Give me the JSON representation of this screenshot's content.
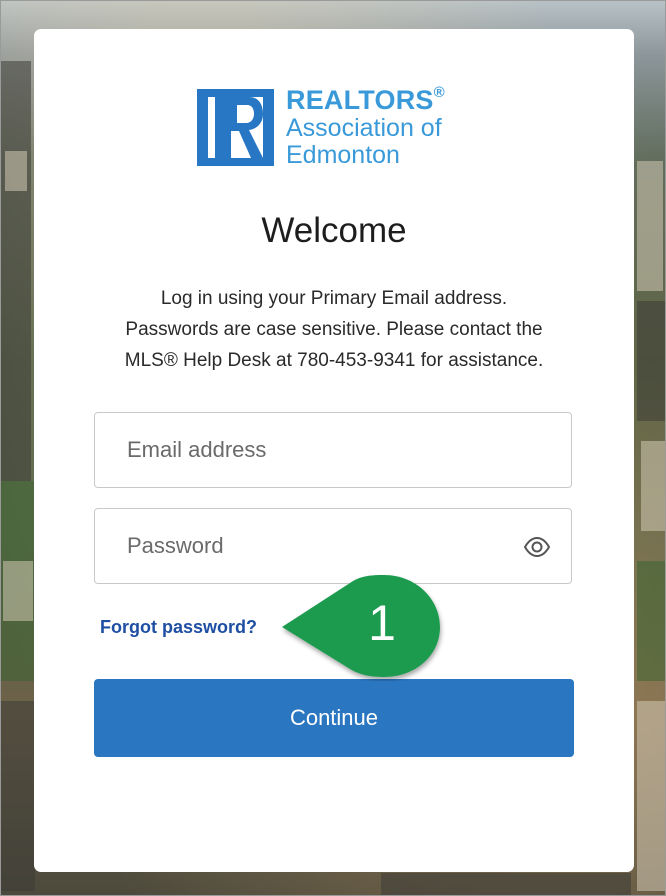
{
  "brand": {
    "line1": "REALTORS",
    "registered": "®",
    "line2": "Association of",
    "line3": "Edmonton",
    "logo_color": "#3a9ad9",
    "logo_icon": "realtor-r-logo-icon"
  },
  "login": {
    "title": "Welcome",
    "instructions": [
      "Log in using your Primary Email address.",
      "Passwords are case sensitive. Please contact the",
      "MLS® Help Desk at 780-453-9341 for assistance."
    ],
    "email_placeholder": "Email address",
    "email_value": "",
    "password_placeholder": "Password",
    "password_value": "",
    "show_password_icon": "eye-icon",
    "forgot_password_label": "Forgot password?",
    "continue_label": "Continue",
    "accent_color": "#2a76c1",
    "link_color": "#1f4fa3"
  },
  "annotation": {
    "step_number": "1",
    "color": "#1e9b4f"
  }
}
